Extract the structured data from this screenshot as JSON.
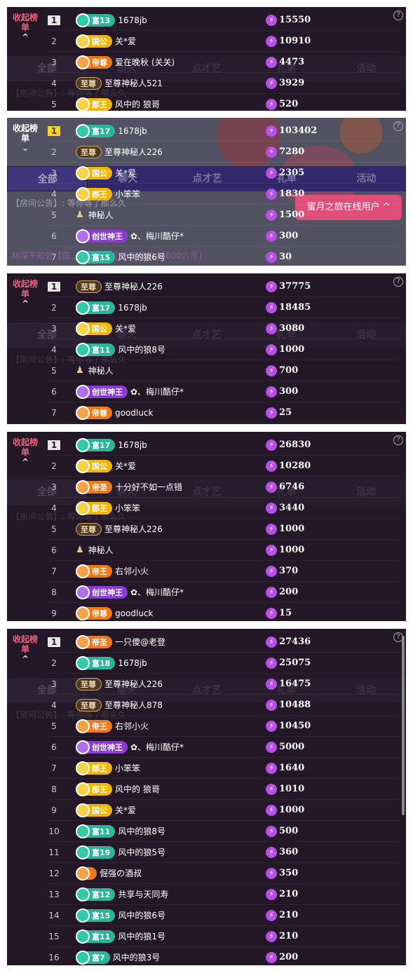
{
  "common": {
    "collapse_label": "收起榜单",
    "help": "?",
    "tabs": [
      "全部",
      "聊天",
      "点才艺",
      "礼单",
      "活动"
    ],
    "notice_label": "【房间公告】:",
    "notice_text": "等你等了那么久"
  },
  "panel2": {
    "honey_button": "蜜月之旅在线用户 ^",
    "chat_line": "林深不知处【国…】我的回忆不是我的 [1600六币]"
  },
  "panels": [
    {
      "rows": [
        {
          "rank": "1",
          "badge": "富13",
          "badge_type": "fu",
          "name": "1678jb",
          "score": "15550"
        },
        {
          "rank": "2",
          "badge": "国公",
          "badge_type": "gold",
          "name": "关*爱",
          "score": "10910"
        },
        {
          "rank": "3",
          "badge": "帝尊",
          "badge_type": "orange",
          "name": "爱在晚秋 (关关)",
          "score": "4473"
        },
        {
          "rank": "4",
          "badge": "至尊",
          "badge_type": "dark",
          "name": "至尊神秘人521",
          "score": "3929"
        },
        {
          "rank": "5",
          "badge": "郡王",
          "badge_type": "gold",
          "name": "风中的 狼哥",
          "score": "520"
        }
      ]
    },
    {
      "rows": [
        {
          "rank": "1",
          "badge": "富17",
          "badge_type": "fu",
          "name": "1678jb",
          "score": "103402"
        },
        {
          "rank": "2",
          "badge": "至尊",
          "badge_type": "dark",
          "name": "至尊神秘人226",
          "score": "7280"
        },
        {
          "rank": "3",
          "badge": "国公",
          "badge_type": "gold",
          "name": "关*爱",
          "score": "2305"
        },
        {
          "rank": "4",
          "badge": "郡王",
          "badge_type": "gold",
          "name": "小笨笨",
          "score": "1830"
        },
        {
          "rank": "5",
          "badge": "",
          "badge_type": "none",
          "name": "神秘人",
          "score": "1500"
        },
        {
          "rank": "6",
          "badge": "创世神王",
          "badge_type": "purple",
          "name": "✿、梅川酷仔*",
          "score": "300"
        },
        {
          "rank": "7",
          "badge": "富15",
          "badge_type": "fu",
          "name": "风中的狼6号",
          "score": "30"
        }
      ]
    },
    {
      "rows": [
        {
          "rank": "1",
          "badge": "至尊",
          "badge_type": "dark",
          "name": "至尊神秘人226",
          "score": "37775"
        },
        {
          "rank": "2",
          "badge": "富17",
          "badge_type": "fu",
          "name": "1678jb",
          "score": "18485"
        },
        {
          "rank": "3",
          "badge": "国公",
          "badge_type": "gold",
          "name": "关*爱",
          "score": "3080"
        },
        {
          "rank": "4",
          "badge": "富11",
          "badge_type": "fu",
          "name": "风中的狼8号",
          "score": "1000"
        },
        {
          "rank": "5",
          "badge": "",
          "badge_type": "none",
          "name": "神秘人",
          "score": "700"
        },
        {
          "rank": "6",
          "badge": "创世神王",
          "badge_type": "purple",
          "name": "✿、梅川酷仔*",
          "score": "300"
        },
        {
          "rank": "7",
          "badge": "帝尊",
          "badge_type": "orange",
          "name": "goodluck",
          "score": "25"
        }
      ]
    },
    {
      "rows": [
        {
          "rank": "1",
          "badge": "富17",
          "badge_type": "fu",
          "name": "1678jb",
          "score": "26830"
        },
        {
          "rank": "2",
          "badge": "国公",
          "badge_type": "gold",
          "name": "关*爱",
          "score": "10280"
        },
        {
          "rank": "3",
          "badge": "帝圣",
          "badge_type": "orange",
          "name": "十分好不如一点错",
          "score": "6746"
        },
        {
          "rank": "4",
          "badge": "郡王",
          "badge_type": "gold",
          "name": "小笨笨",
          "score": "3440"
        },
        {
          "rank": "5",
          "badge": "至尊",
          "badge_type": "dark",
          "name": "至尊神秘人226",
          "score": "1000"
        },
        {
          "rank": "6",
          "badge": "",
          "badge_type": "none",
          "name": "神秘人",
          "score": "1000"
        },
        {
          "rank": "7",
          "badge": "帝王",
          "badge_type": "orange",
          "name": "右邻小火",
          "score": "370"
        },
        {
          "rank": "8",
          "badge": "创世神王",
          "badge_type": "purple",
          "name": "✿、梅川酷仔*",
          "score": "200"
        },
        {
          "rank": "9",
          "badge": "帝尊",
          "badge_type": "orange",
          "name": "goodluck",
          "score": "15"
        }
      ]
    },
    {
      "rows": [
        {
          "rank": "1",
          "badge": "帝圣",
          "badge_type": "orange",
          "name": "一只傻@老登",
          "score": "27436"
        },
        {
          "rank": "2",
          "badge": "富18",
          "badge_type": "fu",
          "name": "1678jb",
          "score": "25075"
        },
        {
          "rank": "3",
          "badge": "至尊",
          "badge_type": "dark",
          "name": "至尊神秘人226",
          "score": "16475"
        },
        {
          "rank": "4",
          "badge": "至尊",
          "badge_type": "dark",
          "name": "至尊神秘人878",
          "score": "10488"
        },
        {
          "rank": "5",
          "badge": "帝王",
          "badge_type": "orange",
          "name": "右邻小火",
          "score": "10450"
        },
        {
          "rank": "6",
          "badge": "创世神王",
          "badge_type": "purple",
          "name": "✿、梅川酷仔*",
          "score": "5000"
        },
        {
          "rank": "7",
          "badge": "郡王",
          "badge_type": "gold",
          "name": "小笨笨",
          "score": "1640"
        },
        {
          "rank": "8",
          "badge": "郡王",
          "badge_type": "gold",
          "name": "风中的 狼哥",
          "score": "1010"
        },
        {
          "rank": "9",
          "badge": "国公",
          "badge_type": "gold",
          "name": "关*爱",
          "score": "1000"
        },
        {
          "rank": "10",
          "badge": "富11",
          "badge_type": "fu",
          "name": "风中的狼8号",
          "score": "500"
        },
        {
          "rank": "11",
          "badge": "富19",
          "badge_type": "fu",
          "name": "风中的狼5号",
          "score": "360"
        },
        {
          "rank": "12",
          "badge": "",
          "badge_type": "orange",
          "name": "倔强の酒叔",
          "score": "350"
        },
        {
          "rank": "13",
          "badge": "富12",
          "badge_type": "fu",
          "name": "共享与天同寿",
          "score": "210"
        },
        {
          "rank": "14",
          "badge": "富15",
          "badge_type": "fu",
          "name": "风中的狼6号",
          "score": "210"
        },
        {
          "rank": "15",
          "badge": "富11",
          "badge_type": "fu",
          "name": "风中的狼1号",
          "score": "210"
        },
        {
          "rank": "16",
          "badge": "富7",
          "badge_type": "fu",
          "name": "风中的狼3号",
          "score": "200"
        }
      ]
    }
  ],
  "colors": {
    "accent_pink": "#e8627a",
    "bolt_purple": "#b84ee8",
    "fu_green": "#2bb59a",
    "gold": "#f2b705",
    "orange": "#f07a1a",
    "purple": "#8c3ad6"
  }
}
